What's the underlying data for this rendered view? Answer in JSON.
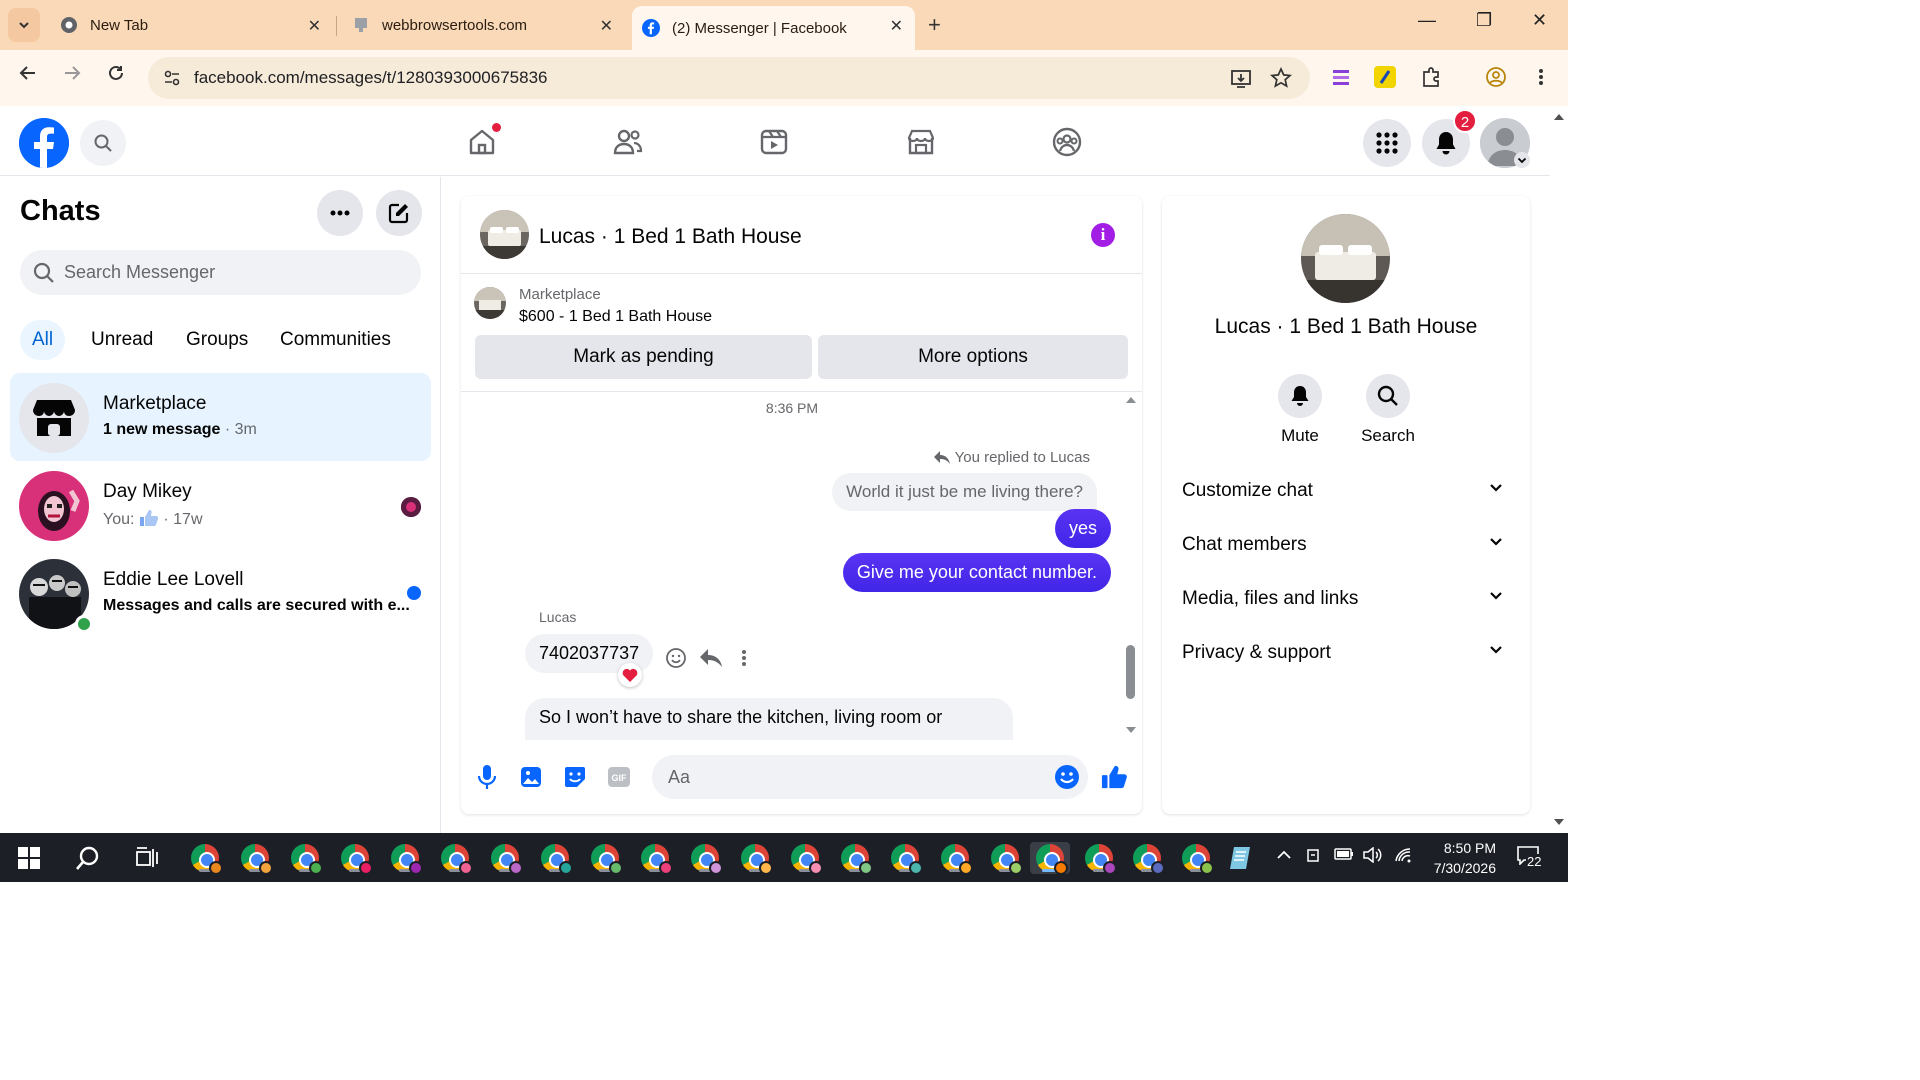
{
  "browser": {
    "tabs": [
      {
        "title": "New Tab",
        "icon": "chrome-icon"
      },
      {
        "title": "webbrowsertools.com",
        "icon": "site-icon"
      },
      {
        "title": "(2) Messenger | Facebook",
        "icon": "facebook-icon",
        "active": true
      }
    ],
    "url": "facebook.com/messages/t/1280393000675836"
  },
  "fb_header": {
    "notifications_count": "2",
    "nav_icons": [
      "home-icon",
      "friends-icon",
      "video-icon",
      "marketplace-icon",
      "groups-icon"
    ]
  },
  "sidebar": {
    "title": "Chats",
    "search_placeholder": "Search Messenger",
    "filters": [
      "All",
      "Unread",
      "Groups",
      "Communities"
    ],
    "chats": [
      {
        "name": "Marketplace",
        "preview": "1 new message",
        "time": "3m"
      },
      {
        "name": "Day Mikey",
        "preview_prefix": "You:",
        "time": "17w"
      },
      {
        "name": "Eddie Lee Lovell",
        "preview": "Messages and calls are secured with e..."
      }
    ]
  },
  "conversation": {
    "title": "Lucas · 1 Bed 1 Bath House",
    "listing": {
      "label": "Marketplace",
      "price_title": "$600 - 1 Bed 1 Bath House",
      "primary_button": "Mark as pending",
      "secondary_button": "More options"
    },
    "timestamp": "8:36 PM",
    "reply_note": "You replied to Lucas",
    "messages": {
      "quoted": "World it just be me living there?",
      "out_1": "yes",
      "out_2": "Give me your contact number.",
      "sender": "Lucas",
      "in_1": "7402037737",
      "in_2": "So I won’t have to share the kitchen, living room or"
    },
    "composer_placeholder": "Aa"
  },
  "info_panel": {
    "name": "Lucas · 1 Bed 1 Bath House",
    "actions": [
      "Mute",
      "Search"
    ],
    "sections": [
      "Customize chat",
      "Chat members",
      "Media, files and links",
      "Privacy & support"
    ]
  },
  "taskbar": {
    "time": "8:50 PM",
    "date": "7/30/2026",
    "notification_count": "22"
  },
  "colors": {
    "facebook_blue": "#0866ff",
    "outgoing_bubble": "#4a2ced",
    "info_purple": "#a31ee4",
    "tab_strip": "#f9d9b8"
  }
}
